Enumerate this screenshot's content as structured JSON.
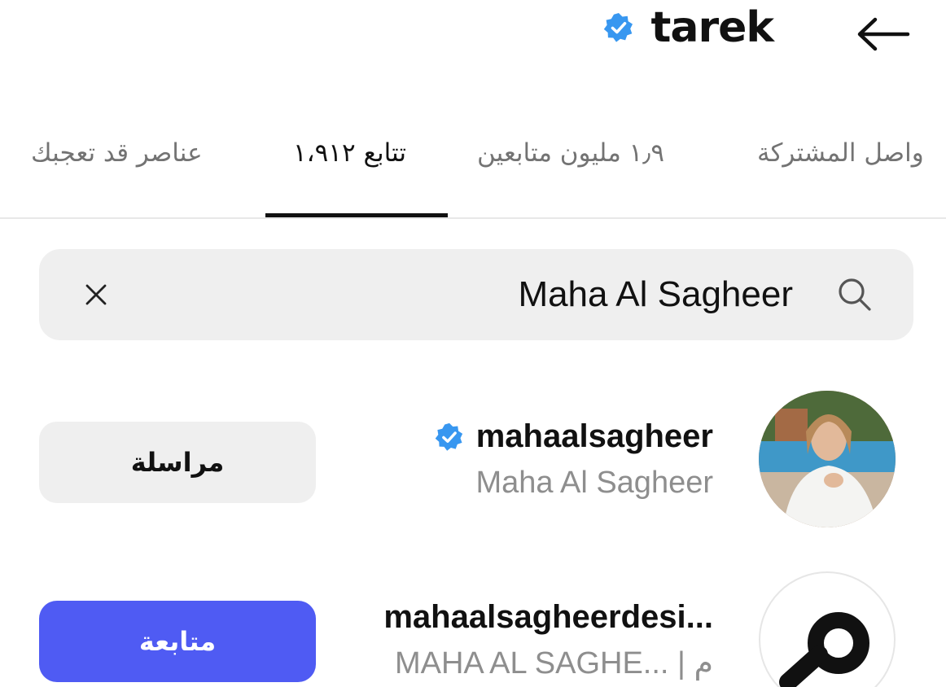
{
  "header": {
    "title": "tarek",
    "verified_icon": "verified-badge-icon",
    "back_icon": "arrow-left-icon"
  },
  "tabs": [
    {
      "label": "عناصر قد تعجبك",
      "active": false
    },
    {
      "label": "تتابع ١،٩١٢",
      "active": true
    },
    {
      "label": "١٫٩ مليون متابعين",
      "active": false
    },
    {
      "label": "واصل المشتركة",
      "active": false
    }
  ],
  "search": {
    "value": "Maha Al Sagheer",
    "clear_icon": "close-icon",
    "search_icon": "search-icon"
  },
  "results": [
    {
      "username": "mahaalsagheer",
      "verified": true,
      "subtitle": "Maha Al Sagheer",
      "button_label": "مراسلة",
      "button_style": "secondary"
    },
    {
      "username": "mahaalsagheerdesi...",
      "verified": false,
      "subtitle": "MAHA AL SAGHE... | م",
      "button_label": "متابعة",
      "button_style": "primary"
    }
  ],
  "colors": {
    "accent_blue": "#4f5bf3",
    "verified_blue": "#3897f0",
    "muted_text": "#8e8e8e",
    "input_bg": "#efefef"
  }
}
